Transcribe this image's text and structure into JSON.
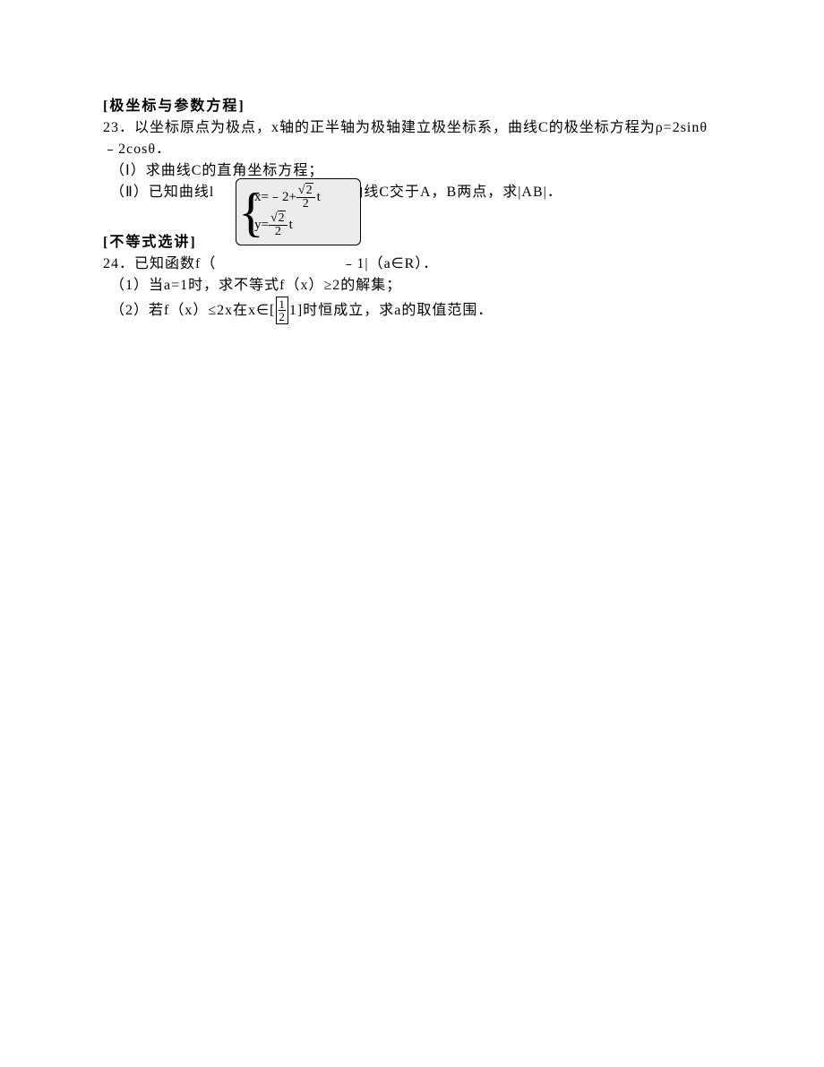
{
  "section1": {
    "header": "[极坐标与参数方程]",
    "q23": {
      "num": "23．",
      "stem": "以坐标原点为极点，x轴的正半轴为极轴建立极坐标系，曲线C的极坐标方程为ρ=2sinθ﹣2cosθ．",
      "p1": "（Ⅰ）求曲线C的直角坐标方程；",
      "p2_before": "（Ⅱ）已知曲线l",
      "p2_after": "曲线C交于A，B两点，求|AB|．",
      "formula": {
        "eq1_lhs": "x=﹣2+",
        "eq2_lhs": "y=",
        "frac_num_sqrt": "2",
        "frac_den": "2",
        "t": "t"
      }
    }
  },
  "section2": {
    "header": "[不等式选讲]",
    "q24": {
      "num": "24．",
      "stem_before": "已知函数f（",
      "stem_after": "﹣1|（a∈R）．",
      "p1": "（1）当a=1时，求不等式f（x）≥2的解集；",
      "p2_before": "（2）若f（x）≤2x在x∈[",
      "p2_after": " 1]时恒成立，求a的取值范围．",
      "frac_num": "1",
      "frac_den": "2"
    }
  }
}
